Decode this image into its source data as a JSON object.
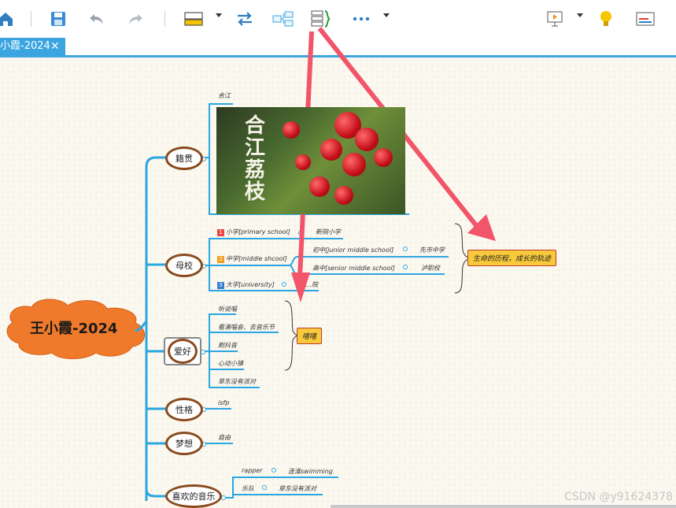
{
  "tab": {
    "title": "小霞-2024",
    "close": "✕"
  },
  "toolbar": {
    "icons": [
      "home-icon",
      "save-icon",
      "undo-icon",
      "redo-icon",
      "style-icon",
      "relation-icon",
      "structure-icon",
      "summary-icon",
      "more-icon",
      "presentation-icon",
      "idea-icon",
      "panel-icon"
    ],
    "accent": "#3aa5e0"
  },
  "map": {
    "root": "王小霞-2024",
    "branches": {
      "hometown": {
        "label": "籍贯",
        "child": "合江",
        "photo_text": "合江荔枝"
      },
      "schools": {
        "label": "母校",
        "items": [
          {
            "num": "1",
            "label": "小学[primary school]",
            "sub": "新院小学"
          },
          {
            "num": "2",
            "label": "中学[middle shcool]"
          },
          {
            "num": "3",
            "label": "大学[university]",
            "sub": "…院"
          }
        ],
        "middle": [
          {
            "label": "初中[junior middle school]",
            "sub": "先市中学"
          },
          {
            "label": "高中[senior middle school]",
            "sub": "泸职校"
          }
        ]
      },
      "hobbies": {
        "label": "爱好",
        "items": [
          "听说唱",
          "看演唱会、去音乐节",
          "刷抖音",
          "心动小镇",
          "草东没有派对"
        ]
      },
      "personality": {
        "label": "性格",
        "child": "isfp"
      },
      "dream": {
        "label": "梦想",
        "child": "自由"
      },
      "music": {
        "label": "喜欢的音乐",
        "items": [
          {
            "label": "rapper",
            "sub": "连淮swimming"
          },
          {
            "label": "乐队",
            "sub": "草东没有派对"
          }
        ]
      }
    },
    "callouts": {
      "life": "生命的历程，成长的轨迹",
      "haha": "嘻嘻"
    }
  },
  "watermark": "CSDN @y91624378",
  "colors": {
    "branch_line": "#2ba6e1",
    "oval_border": "#8a4a1c",
    "root_fill": "#f07a2b",
    "callout_fill": "#f7c93b",
    "arrow": "#f2546a"
  }
}
